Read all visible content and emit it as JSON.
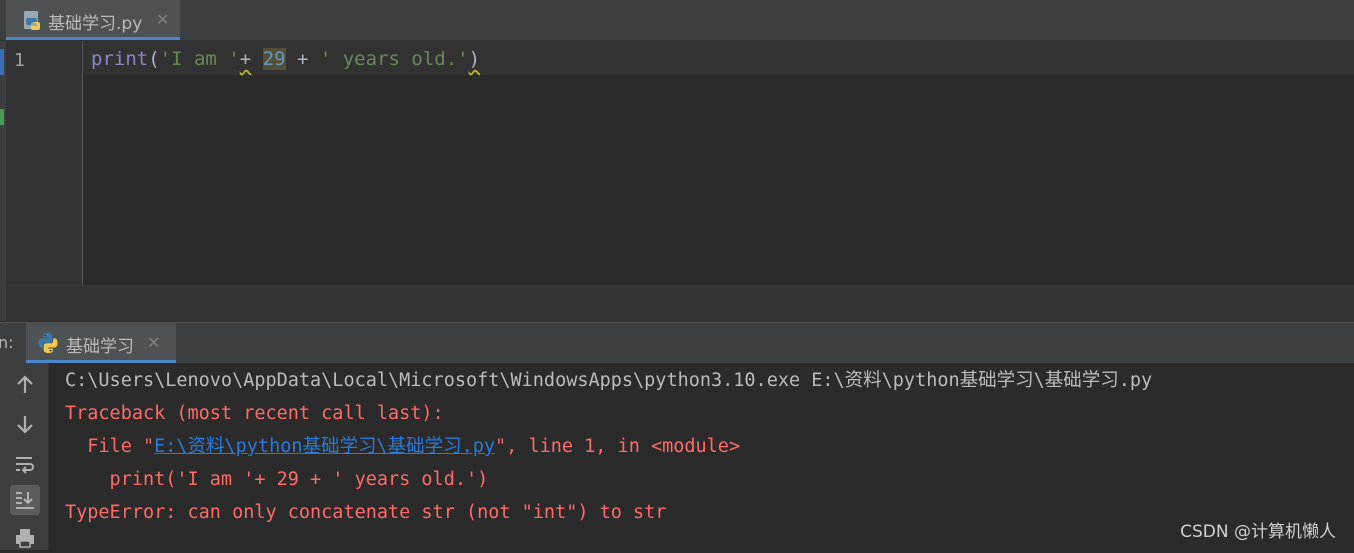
{
  "editor_tab": {
    "label": "基础学习.py",
    "close": "✕"
  },
  "editor": {
    "line_number": "1",
    "code": {
      "fn": "print",
      "open": "(",
      "str1": "'I am '",
      "plus1": "+",
      "num": "29",
      "plus2": " + ",
      "str2": "' years old.'",
      "close": ")"
    }
  },
  "run": {
    "prefix": "n:",
    "tab_label": "基础学习",
    "close": "✕"
  },
  "console": {
    "cmd": "C:\\Users\\Lenovo\\AppData\\Local\\Microsoft\\WindowsApps\\python3.10.exe E:\\资料\\python基础学习\\基础学习.py",
    "traceback": "Traceback (most recent call last):",
    "file_prefix": "  File \"",
    "file_link": "E:\\资料\\python基础学习\\基础学习.py",
    "file_suffix": "\", line 1, in <module>",
    "code_line": "    print('I am '+ 29 + ' years old.')",
    "error": "TypeError: can only concatenate str (not \"int\") to str"
  },
  "watermark": "CSDN @计算机懒人",
  "toolbar_icons": [
    "arrow-up-icon",
    "arrow-down-icon",
    "soft-wrap-icon",
    "scroll-to-end-icon",
    "print-icon"
  ],
  "colors": {
    "accent": "#4a88c7",
    "error": "#ff6b68",
    "link": "#287bde",
    "string": "#6a8759",
    "number": "#6897bb",
    "builtin": "#8888c6"
  }
}
